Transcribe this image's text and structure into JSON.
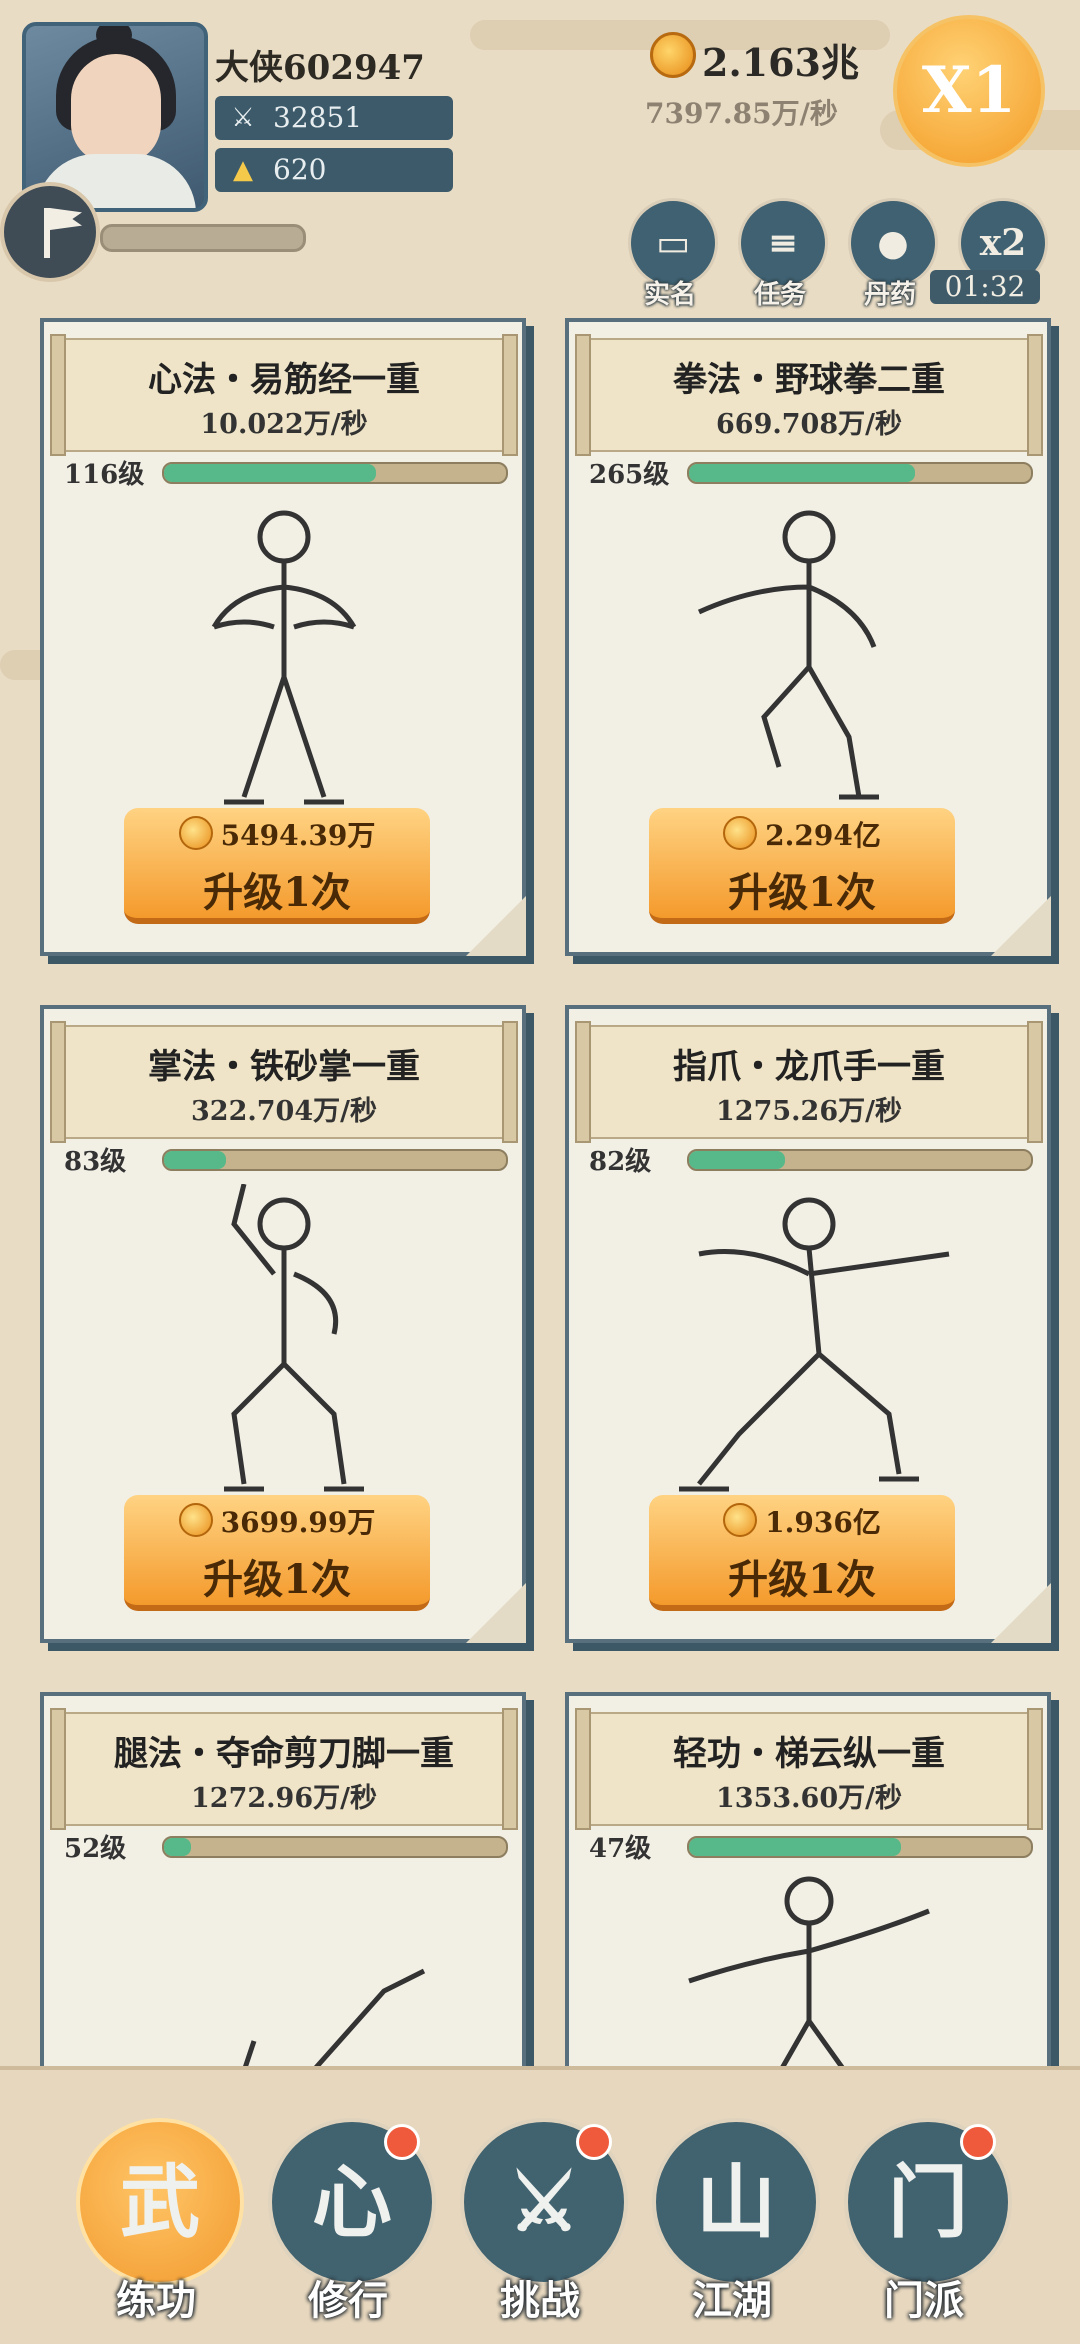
{
  "player": {
    "name": "大侠602947",
    "power": "32851",
    "gold": "620"
  },
  "currency": {
    "amount": "2.163兆",
    "rate": "7397.85万/秒",
    "multiplier": "X1"
  },
  "quick": [
    {
      "label": "实名",
      "icon": "id-card-icon"
    },
    {
      "label": "任务",
      "icon": "scroll-icon"
    },
    {
      "label": "丹药",
      "icon": "pill-icon"
    },
    {
      "label": "x2",
      "icon": "double-icon"
    }
  ],
  "timer": "01:32",
  "cards": [
    {
      "title": "心法・易筋经一重",
      "rate": "10.022万/秒",
      "level": "116级",
      "progress": 0.62,
      "cost": "5494.39万",
      "button": "升级1次"
    },
    {
      "title": "拳法・野球拳二重",
      "rate": "669.708万/秒",
      "level": "265级",
      "progress": 0.66,
      "cost": "2.294亿",
      "button": "升级1次"
    },
    {
      "title": "掌法・铁砂掌一重",
      "rate": "322.704万/秒",
      "level": "83级",
      "progress": 0.18,
      "cost": "3699.99万",
      "button": "升级1次"
    },
    {
      "title": "指爪・龙爪手一重",
      "rate": "1275.26万/秒",
      "level": "82级",
      "progress": 0.28,
      "cost": "1.936亿",
      "button": "升级1次"
    },
    {
      "title": "腿法・夺命剪刀脚一重",
      "rate": "1272.96万/秒",
      "level": "52级",
      "progress": 0.08,
      "cost": "",
      "button": ""
    },
    {
      "title": "轻功・梯云纵一重",
      "rate": "1353.60万/秒",
      "level": "47级",
      "progress": 0.62,
      "cost": "",
      "button": ""
    }
  ],
  "nav": [
    {
      "label": "练功",
      "glyph": "武"
    },
    {
      "label": "修行",
      "glyph": "心"
    },
    {
      "label": "挑战",
      "glyph": "⚔"
    },
    {
      "label": "江湖",
      "glyph": "山"
    },
    {
      "label": "门派",
      "glyph": "门"
    }
  ]
}
